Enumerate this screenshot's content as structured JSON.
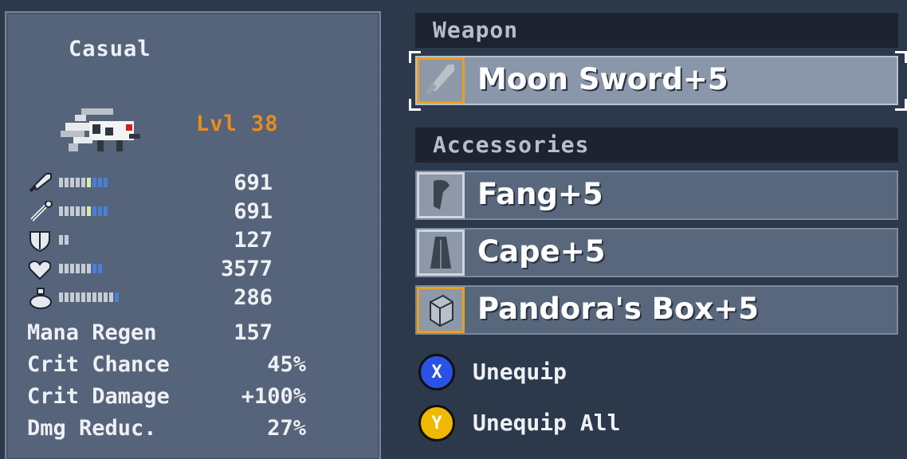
{
  "difficulty": "Casual",
  "level": "Lvl 38",
  "stats": [
    {
      "icon": "sword-icon",
      "value": "691",
      "pips": [
        "g",
        "g",
        "g",
        "g",
        "g",
        "y",
        "b",
        "b",
        "b"
      ]
    },
    {
      "icon": "staff-icon",
      "value": "691",
      "pips": [
        "g",
        "g",
        "g",
        "g",
        "g",
        "y",
        "b",
        "b",
        "b"
      ]
    },
    {
      "icon": "shield-icon",
      "value": "127",
      "pips": [
        "g",
        "g"
      ]
    },
    {
      "icon": "heart-icon",
      "value": "3577",
      "pips": [
        "g",
        "g",
        "g",
        "g",
        "g",
        "g",
        "b",
        "b"
      ]
    },
    {
      "icon": "potion-icon",
      "value": "286",
      "pips": [
        "g",
        "g",
        "g",
        "g",
        "g",
        "g",
        "g",
        "g",
        "g",
        "g",
        "b"
      ]
    }
  ],
  "secondary": [
    {
      "label": "Mana Regen",
      "value": "157"
    },
    {
      "label": "Crit Chance",
      "value": "45%"
    },
    {
      "label": "Crit Damage",
      "value": "+100%"
    },
    {
      "label": "Dmg Reduc.",
      "value": "27%"
    }
  ],
  "weapon_header": "Weapon",
  "weapon": {
    "name": "Moon Sword+5",
    "icon": "sword-icon"
  },
  "accessories_header": "Accessories",
  "accessories": [
    {
      "name": "Fang+5",
      "icon": "fang-icon"
    },
    {
      "name": "Cape+5",
      "icon": "cape-icon"
    },
    {
      "name": "Pandora's Box+5",
      "icon": "box-icon"
    }
  ],
  "prompts": [
    {
      "button": "X",
      "label": "Unequip",
      "color": "#2a52e6"
    },
    {
      "button": "Y",
      "label": "Unequip All",
      "color": "#f0b800"
    }
  ],
  "colors": {
    "level": "#e98d1a",
    "pip_blue": "#4a7fd6",
    "pip_yellow": "#dfe8a8",
    "selected_slot": "#8a97aa"
  }
}
